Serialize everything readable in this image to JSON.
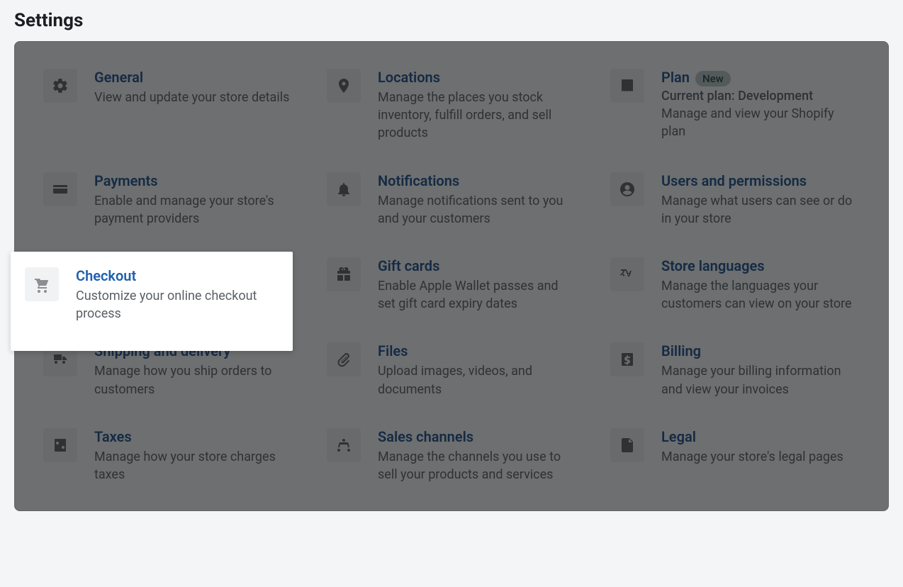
{
  "page_title": "Settings",
  "tiles": {
    "general": {
      "title": "General",
      "desc": "View and update your store details"
    },
    "locations": {
      "title": "Locations",
      "desc": "Manage the places you stock inventory, fulfill orders, and sell products"
    },
    "plan": {
      "title": "Plan",
      "badge": "New",
      "subtitle": "Current plan: Development",
      "desc": "Manage and view your Shopify plan"
    },
    "payments": {
      "title": "Payments",
      "desc": "Enable and manage your store's payment providers"
    },
    "notifications": {
      "title": "Notifications",
      "desc": "Manage notifications sent to you and your customers"
    },
    "users": {
      "title": "Users and permissions",
      "desc": "Manage what users can see or do in your store"
    },
    "checkout": {
      "title": "Checkout",
      "desc": "Customize your online checkout process"
    },
    "giftcards": {
      "title": "Gift cards",
      "desc": "Enable Apple Wallet passes and set gift card expiry dates"
    },
    "languages": {
      "title": "Store languages",
      "desc": "Manage the languages your customers can view on your store"
    },
    "shipping": {
      "title": "Shipping and delivery",
      "desc": "Manage how you ship orders to customers"
    },
    "files": {
      "title": "Files",
      "desc": "Upload images, videos, and documents"
    },
    "billing": {
      "title": "Billing",
      "desc": "Manage your billing information and view your invoices"
    },
    "taxes": {
      "title": "Taxes",
      "desc": "Manage how your store charges taxes"
    },
    "sales": {
      "title": "Sales channels",
      "desc": "Manage the channels you use to sell your products and services"
    },
    "legal": {
      "title": "Legal",
      "desc": "Manage your store's legal pages"
    }
  }
}
